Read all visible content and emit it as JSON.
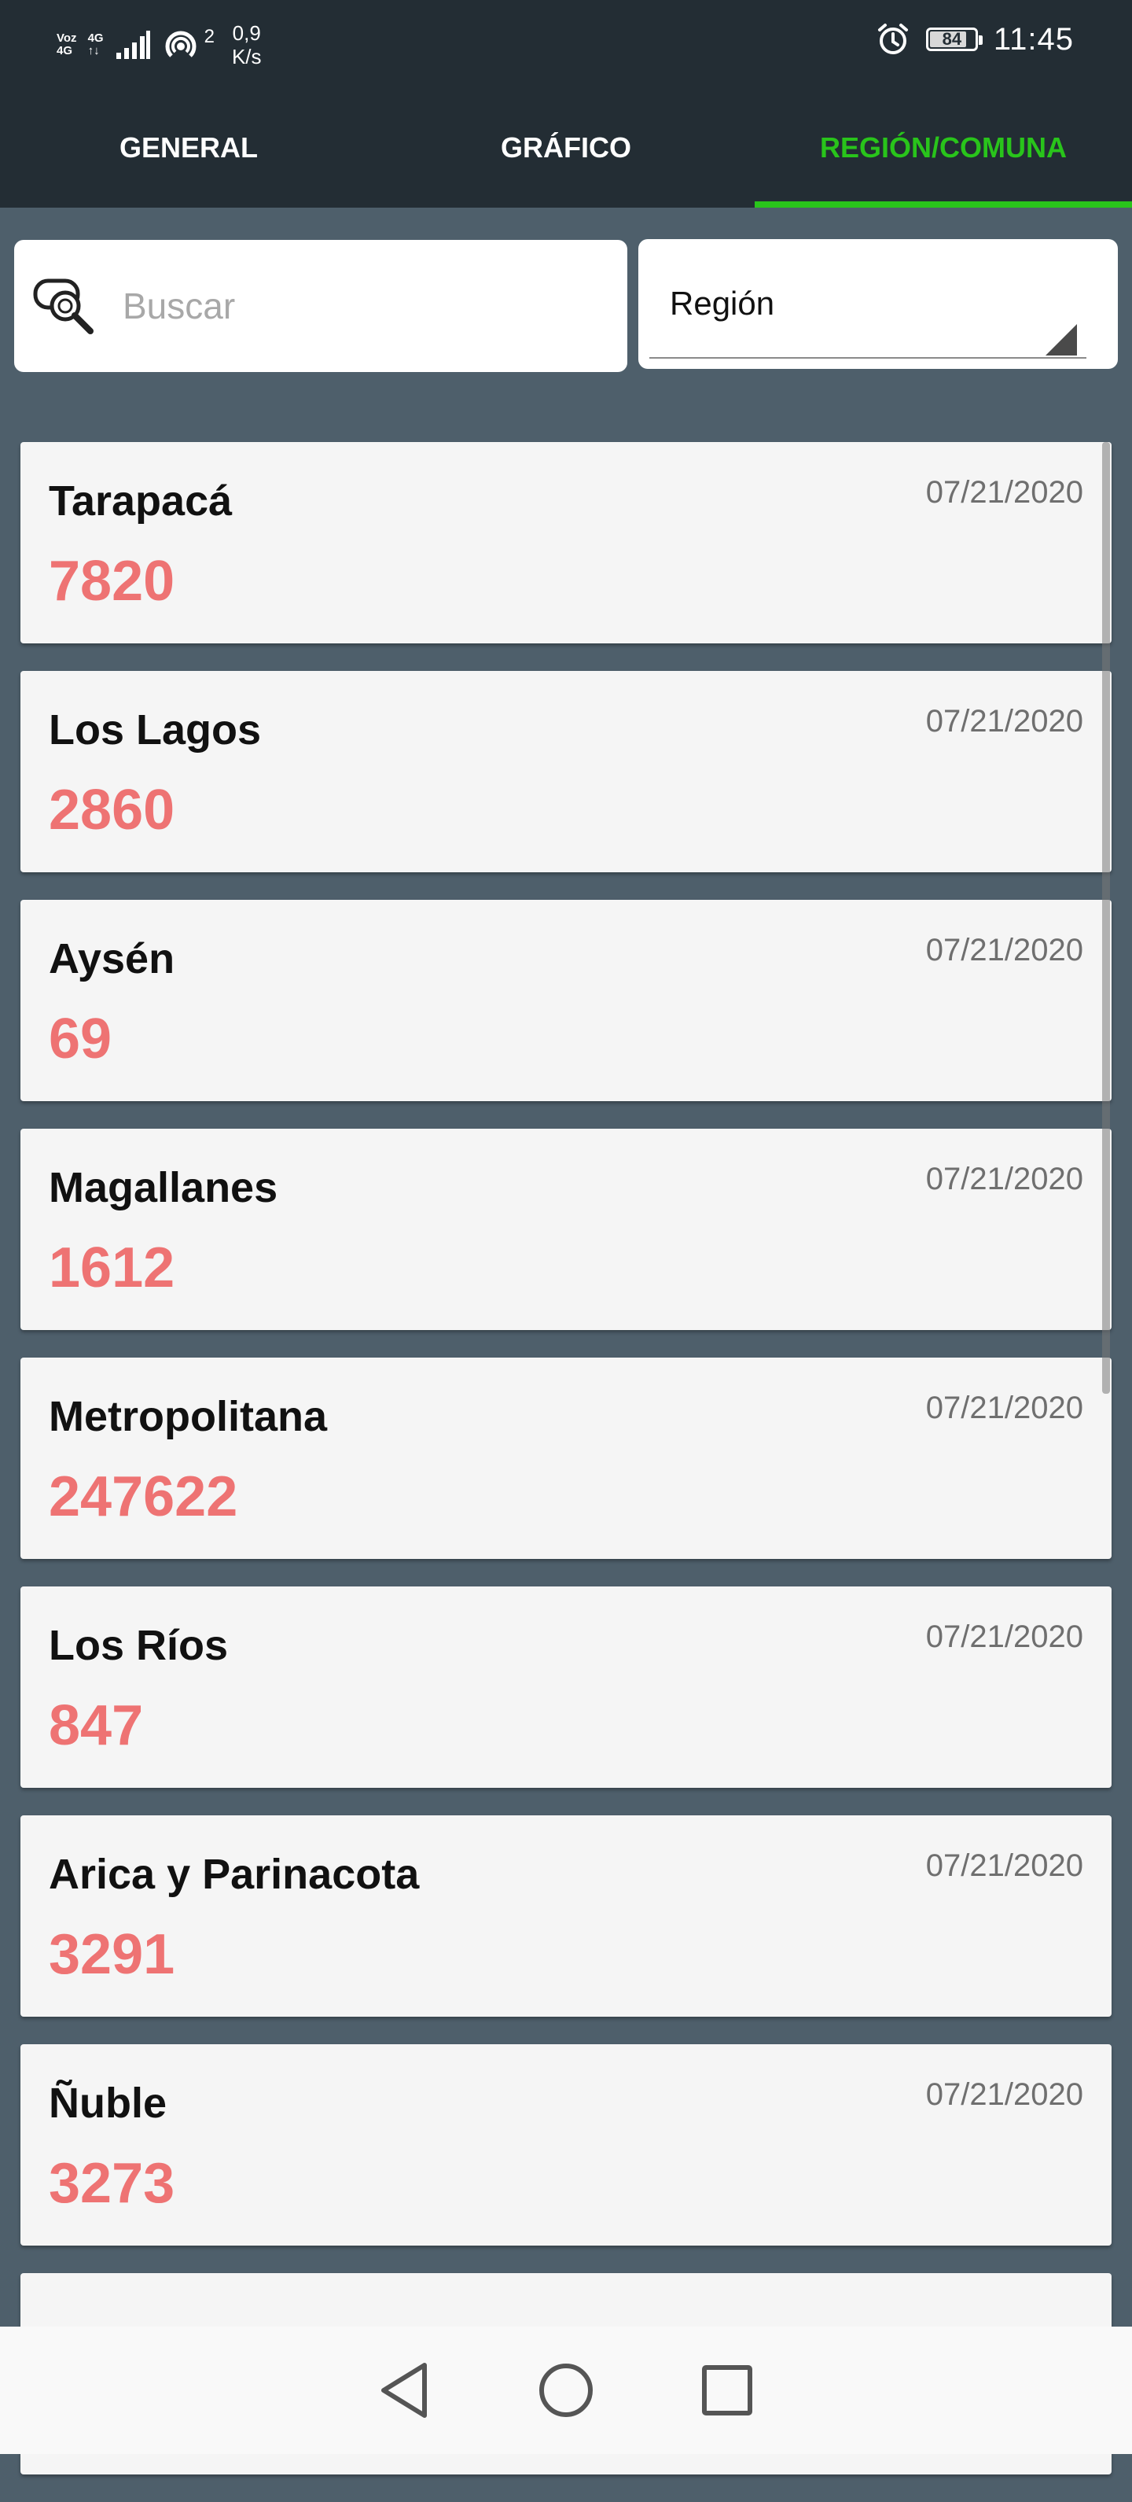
{
  "status_bar": {
    "voz_label": "Voz",
    "lte_label": "4G",
    "signal_label": "4G",
    "hotspot_count": "2",
    "net_speed_value": "0,9",
    "net_speed_unit": "K/s",
    "battery": "84",
    "battery_level_percent": 84,
    "time": "11:45",
    "icons": [
      "signal-icon",
      "hotspot-icon",
      "alarm-icon",
      "battery-icon"
    ]
  },
  "tabs": [
    {
      "label": "GENERAL",
      "active": false
    },
    {
      "label": "GRÁFICO",
      "active": false
    },
    {
      "label": "REGIÓN/COMUNA",
      "active": true
    }
  ],
  "search": {
    "placeholder": "Buscar",
    "value": "",
    "icon": "search-icon"
  },
  "region_select": {
    "value": "Región",
    "icon": "dropdown-arrow-icon"
  },
  "items": [
    {
      "name": "Tarapacá",
      "date": "07/21/2020",
      "value": "7820"
    },
    {
      "name": "Los Lagos",
      "date": "07/21/2020",
      "value": "2860"
    },
    {
      "name": "Aysén",
      "date": "07/21/2020",
      "value": "69"
    },
    {
      "name": "Magallanes",
      "date": "07/21/2020",
      "value": "1612"
    },
    {
      "name": "Metropolitana",
      "date": "07/21/2020",
      "value": "247622"
    },
    {
      "name": "Los Ríos",
      "date": "07/21/2020",
      "value": "847"
    },
    {
      "name": "Arica y Parinacota",
      "date": "07/21/2020",
      "value": "3291"
    },
    {
      "name": "Ñuble",
      "date": "07/21/2020",
      "value": "3273"
    },
    {
      "name": "",
      "date": "",
      "value": ""
    }
  ],
  "nav_bar": {
    "icons": [
      "back-icon",
      "home-icon",
      "recents-icon"
    ]
  },
  "colors": {
    "header_bg": "#232d34",
    "page_bg": "#4e5f6b",
    "accent_green": "#29c41b",
    "value_red": "#ee7373",
    "card_bg": "#f5f5f5",
    "date_gray": "#6f6f6f"
  }
}
